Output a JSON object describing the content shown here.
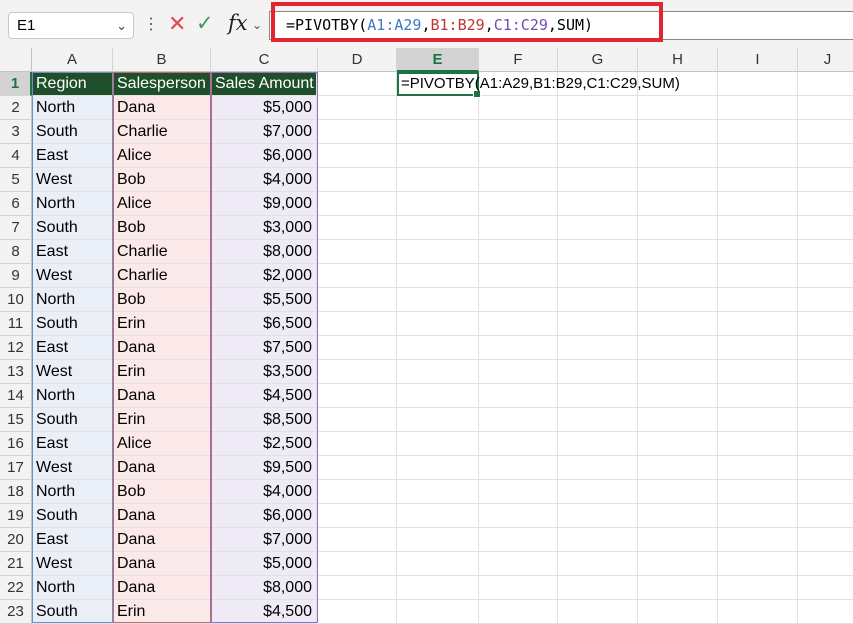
{
  "name_box": {
    "value": "E1"
  },
  "formula_bar": {
    "fx_label": "fx",
    "cancel_symbol": "✕",
    "enter_symbol": "✓",
    "formula_prefix": "=PIVOTBY(",
    "ref_a": "A1:A29",
    "comma1": ",",
    "ref_b": "B1:B29",
    "comma2": ",",
    "ref_c": "C1:C29",
    "formula_suffix": ",SUM)"
  },
  "columns": [
    "A",
    "B",
    "C",
    "D",
    "E",
    "F",
    "G",
    "H",
    "I",
    "J"
  ],
  "selected_column": "E",
  "selected_row": "1",
  "active_cell_text": "=PIVOTBY(A1:A29,B1:B29,C1:C29,SUM)",
  "table": {
    "headers": [
      "Region",
      "Salesperson",
      "Sales Amount"
    ],
    "rows": [
      [
        "North",
        "Dana",
        "$5,000"
      ],
      [
        "South",
        "Charlie",
        "$7,000"
      ],
      [
        "East",
        "Alice",
        "$6,000"
      ],
      [
        "West",
        "Bob",
        "$4,000"
      ],
      [
        "North",
        "Alice",
        "$9,000"
      ],
      [
        "South",
        "Bob",
        "$3,000"
      ],
      [
        "East",
        "Charlie",
        "$8,000"
      ],
      [
        "West",
        "Charlie",
        "$2,000"
      ],
      [
        "North",
        "Bob",
        "$5,500"
      ],
      [
        "South",
        "Erin",
        "$6,500"
      ],
      [
        "East",
        "Dana",
        "$7,500"
      ],
      [
        "West",
        "Erin",
        "$3,500"
      ],
      [
        "North",
        "Dana",
        "$4,500"
      ],
      [
        "South",
        "Erin",
        "$8,500"
      ],
      [
        "East",
        "Alice",
        "$2,500"
      ],
      [
        "West",
        "Dana",
        "$9,500"
      ],
      [
        "North",
        "Bob",
        "$4,000"
      ],
      [
        "South",
        "Dana",
        "$6,000"
      ],
      [
        "East",
        "Dana",
        "$7,000"
      ],
      [
        "West",
        "Dana",
        "$5,000"
      ],
      [
        "North",
        "Dana",
        "$8,000"
      ],
      [
        "South",
        "Erin",
        "$4,500"
      ]
    ]
  },
  "row_numbers": [
    "1",
    "2",
    "3",
    "4",
    "5",
    "6",
    "7",
    "8",
    "9",
    "10",
    "11",
    "12",
    "13",
    "14",
    "15",
    "16",
    "17",
    "18",
    "19",
    "20",
    "21",
    "22",
    "23"
  ],
  "colors": {
    "accent": "#1e7145",
    "header_fill": "#1f4f2a",
    "highlight_border": "#e0262e",
    "ref_a": "#3a7ac6",
    "ref_b": "#c0352f",
    "ref_c": "#7a4ab8"
  }
}
